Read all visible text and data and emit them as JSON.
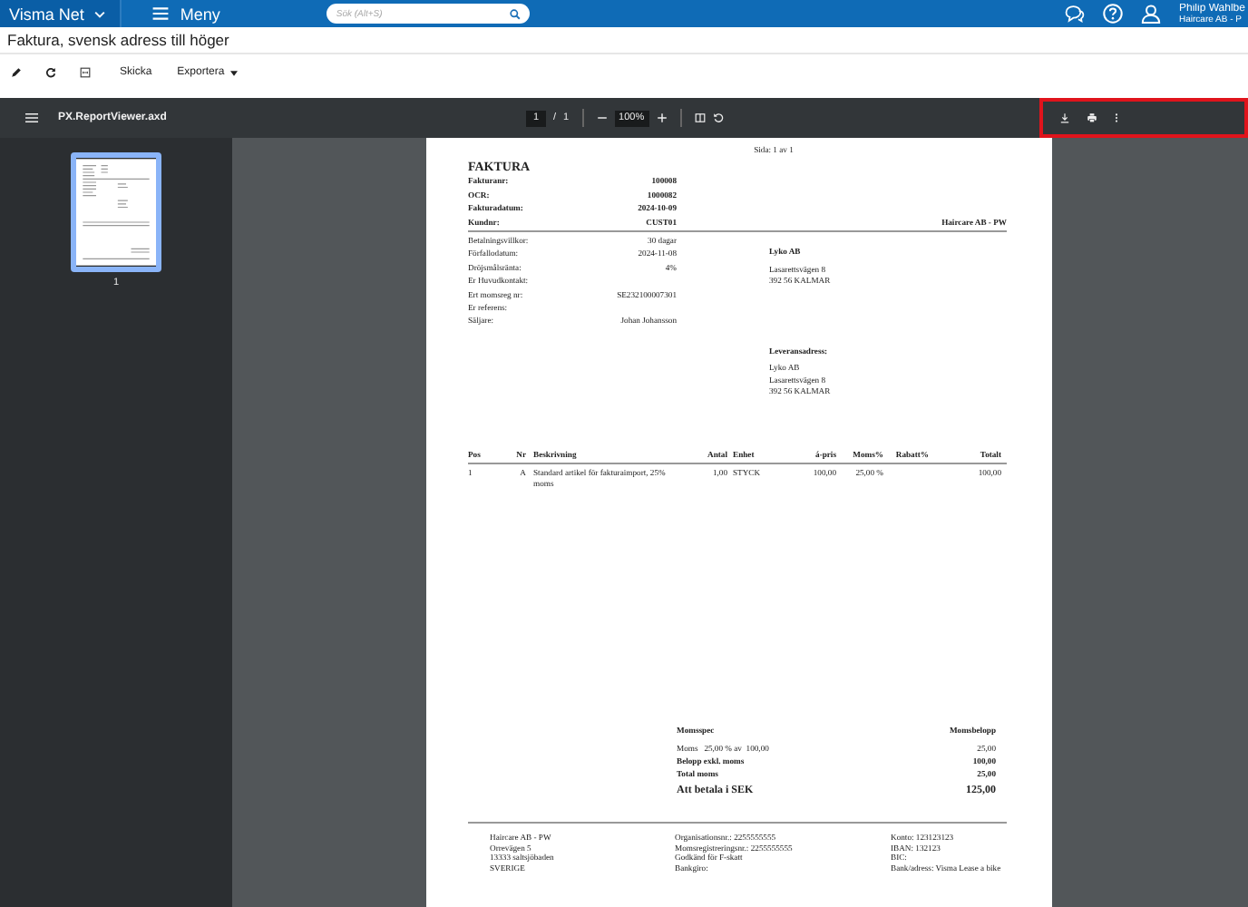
{
  "topbar": {
    "brand": "Visma Net",
    "menu": "Meny",
    "search": {
      "placeholder": "Sök (Alt+S)"
    },
    "user": {
      "name": "Philip Wahlbe",
      "company": "Haircare AB - P"
    }
  },
  "page_title": "Faktura, svensk adress till höger",
  "toolbar": {
    "buttons": [
      "Skicka"
    ],
    "dropdown": "Exportera"
  },
  "viewer": {
    "file": "PX.ReportViewer.axd",
    "page": "1",
    "separator": "/",
    "pages": "1",
    "zoom": "100%",
    "actions_highlighted": true,
    "thumbnails": [
      {
        "label": "1",
        "selected": true
      }
    ]
  },
  "invoice": {
    "page_label": "Sida: 1 av 1",
    "title": "FAKTURA",
    "header_fields": [
      {
        "label": "Fakturanr:",
        "value": "100008"
      },
      {
        "label": "OCR:",
        "value": "1000082"
      },
      {
        "label": "Fakturadatum:",
        "value": "2024-10-09"
      },
      {
        "label": "Kundnr:",
        "value": "CUST01"
      }
    ],
    "sender": "Haircare AB - PW",
    "detail_fields": [
      {
        "label": "Betalningsvillkor:",
        "value": "30 dagar"
      },
      {
        "label": "Förfallodatum:",
        "value": "2024-11-08"
      },
      {
        "label": "Dröjsmålsränta:",
        "value": "4%"
      },
      {
        "label": "Er Huvudkontakt:"
      },
      {
        "label": "Ert momsreg nr:",
        "value": "SE232100007301"
      },
      {
        "label": "Er referens:"
      },
      {
        "label": "Säljare:",
        "value": "Johan Johansson"
      }
    ],
    "billing_address": {
      "name": "Lyko AB",
      "lines": [
        "Lasarettsvägen 8",
        "392 56 KALMAR"
      ]
    },
    "delivery_address": {
      "heading": "Leveransadress:",
      "lines": [
        "Lyko AB",
        "Lasarettsvägen 8",
        "392 56 KALMAR"
      ]
    },
    "table": {
      "columns": [
        "Pos",
        "Nr",
        "Beskrivning",
        "Antal",
        "Enhet",
        "á-pris",
        "Moms%",
        "Rabatt%",
        "Totalt"
      ],
      "rows": [
        [
          "1",
          "A",
          "Standard artikel för fakturaimport, 25% moms",
          "1,00",
          "STYCK",
          "100,00",
          "25,00 %",
          null,
          "100,00"
        ]
      ]
    },
    "vat": {
      "heading": "Momsspec",
      "amount_heading": "Momsbelopp",
      "rows": [
        {
          "kind": "plain",
          "label": "Moms   25,00 % av  100,00",
          "value": "25,00"
        },
        {
          "kind": "bold",
          "label": "Belopp exkl. moms",
          "value": "100,00"
        },
        {
          "kind": "bold",
          "label": "Total moms",
          "value": "25,00"
        },
        {
          "kind": "total",
          "label": "Att betala i SEK",
          "value": "125,00"
        }
      ]
    },
    "footer": [
      [
        "Haircare AB - PW",
        "Orrevägen 5",
        "13333 saltsjöbaden",
        "SVERIGE"
      ],
      [
        "Organisationsnr.: 2255555555",
        "Momsregistreringsnr.: 2255555555",
        "Godkänd för F-skatt",
        "Bankgiro:"
      ],
      [
        "Konto: 123123123",
        "IBAN: 132123",
        "BIC:",
        "Bank/adress: Visma Lease a bike"
      ]
    ]
  }
}
